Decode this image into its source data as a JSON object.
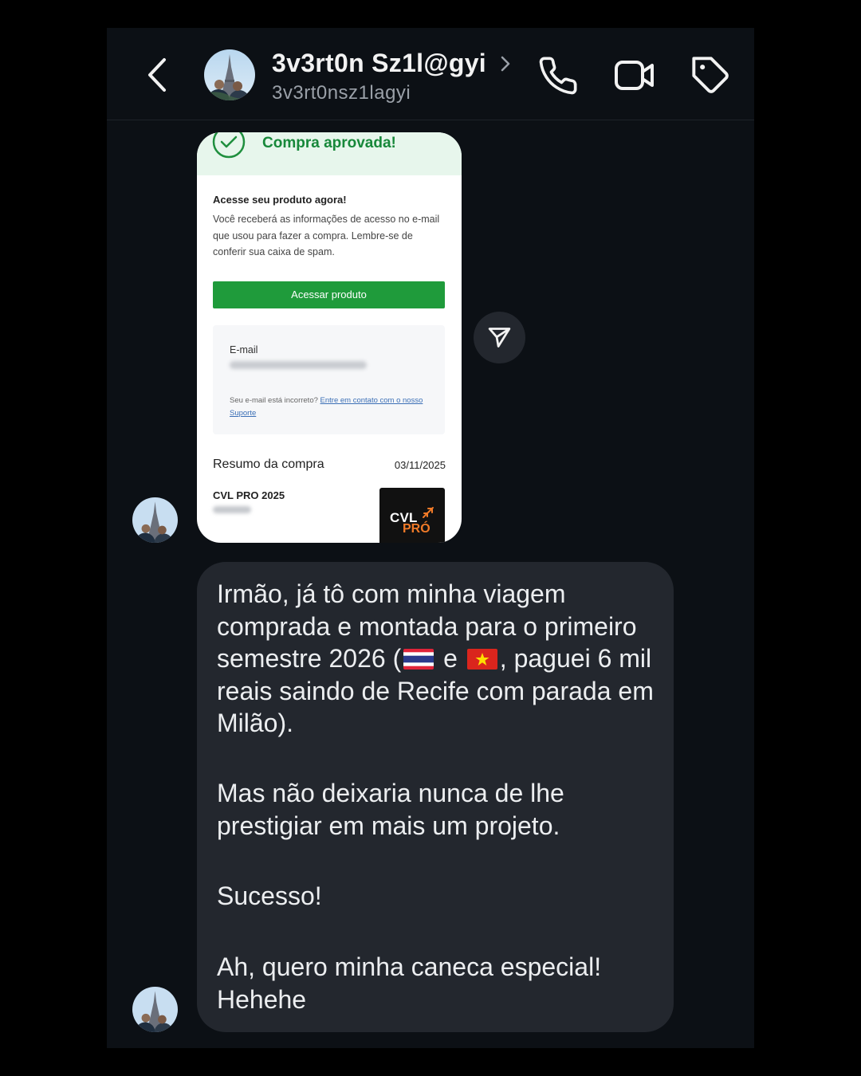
{
  "header": {
    "contact_name": "3v3rt0n Sz1l@gyi",
    "contact_handle": "3v3rt0nsz1lagyi",
    "icons": [
      "back-arrow-icon",
      "chevron-right-icon",
      "phone-icon",
      "video-camera-icon",
      "tag-icon"
    ]
  },
  "shared_card": {
    "title": "Compra aprovada!",
    "access_title": "Acesse seu produto agora!",
    "access_desc": "Você receberá as informações de acesso no e-mail que usou para fazer a compra. Lembre-se de conferir sua caixa de spam.",
    "access_button": "Acessar produto",
    "email_label": "E-mail",
    "email_note_prefix": "Seu e-mail está incorreto? ",
    "email_note_link": "Entre em contato com o nosso Suporte",
    "summary_label": "Resumo da compra",
    "summary_date": "03/11/2025",
    "product_name": "CVL PRO 2025",
    "logo_text_top": "CVL",
    "logo_text_bottom": "PRÓ"
  },
  "message": {
    "p1_before_flags": "Irmão, já tô com minha viagem comprada e montada para o primeiro semestre 2026 (",
    "p1_between_flags": " e ",
    "p1_after_flags": ", paguei 6 mil reais saindo de Recife com parada em Milão).",
    "flags": [
      "thailand-flag",
      "vietnam-flag"
    ],
    "p2": "Mas não deixaria nunca de lhe prestigiar em mais um projeto.",
    "p3": "Sucesso!",
    "p4": "Ah, quero minha caneca especial! Hehehe"
  },
  "colors": {
    "background": "#0c1015",
    "bubble": "#23272e",
    "approved_green": "#17883a",
    "button_green": "#1f9b3b",
    "logo_orange": "#f07a28"
  }
}
